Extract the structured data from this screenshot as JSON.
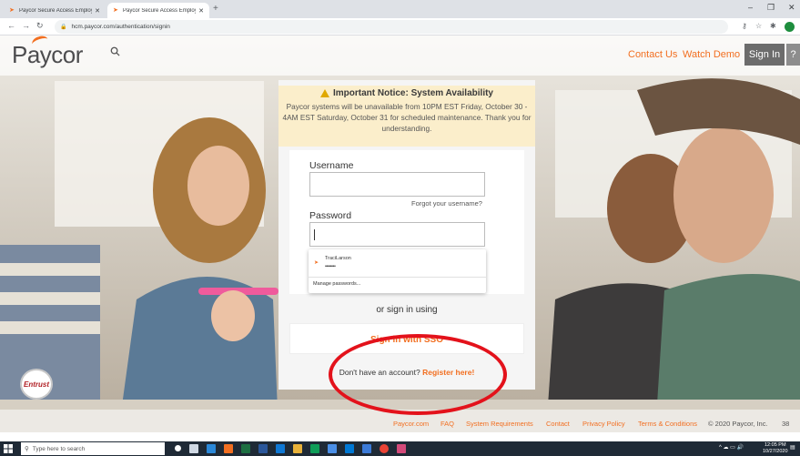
{
  "browser": {
    "tabs": [
      {
        "title": "Paycor Secure Access Employee",
        "active": false
      },
      {
        "title": "Paycor Secure Access Employee",
        "active": true
      }
    ],
    "address": "hcm.paycor.com/authentication/signin"
  },
  "header": {
    "logo_text": "Paycor",
    "contact_label": "Contact Us",
    "demo_label": "Watch Demo",
    "signin_label": "Sign In",
    "help_label": "?"
  },
  "notice": {
    "title": "Important Notice: System Availability",
    "body": "Paycor systems will be unavailable from 10PM EST Friday, October 30 - 4AM EST Saturday, October 31 for scheduled maintenance. Thank you for understanding."
  },
  "login": {
    "username_label": "Username",
    "username_value": "",
    "forgot_label": "Forgot your username?",
    "password_label": "Password",
    "password_value": "",
    "saved_user": "TraciLarson",
    "saved_password_mask": "••••••••",
    "manage_passwords": "Manage passwords...",
    "or_text": "or sign in using",
    "sso_label": "Sign in with SSO",
    "register_prompt": "Don't have an account?",
    "register_link": "Register here!"
  },
  "footer": {
    "badge": "Entrust",
    "links": [
      "Paycor.com",
      "FAQ",
      "System Requirements",
      "Contact",
      "Privacy Policy",
      "Terms & Conditions"
    ],
    "copyright": "© 2020 Paycor, Inc.",
    "version": "38"
  },
  "taskbar": {
    "search_placeholder": "Type here to search",
    "time": "12:05 PM",
    "date": "10/27/2020"
  },
  "colors": {
    "brand_orange": "#f26f21",
    "annotation_red": "#e3121b",
    "notice_bg": "#fbeecb"
  }
}
